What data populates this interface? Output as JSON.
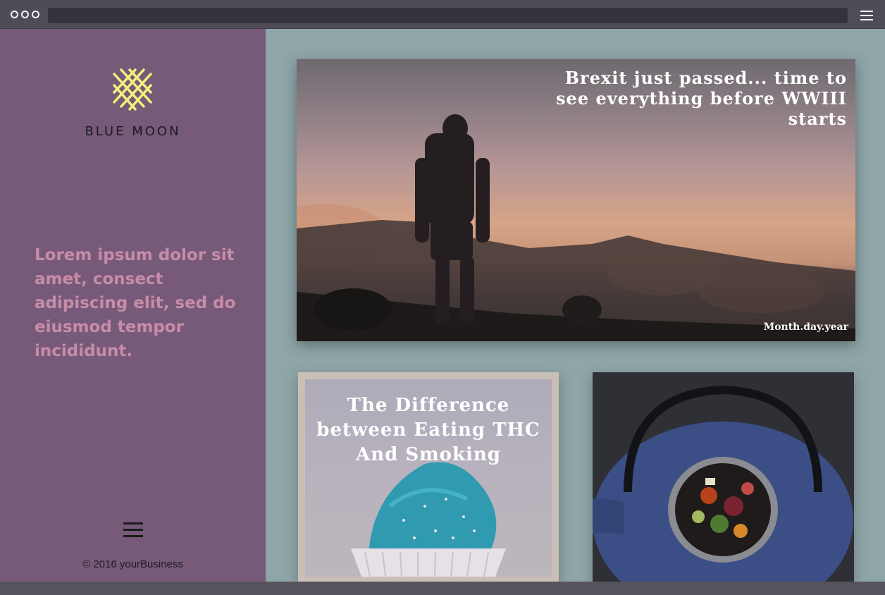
{
  "browser": {
    "icons": [
      "window-dots-icon",
      "hamburger-menu-icon"
    ]
  },
  "sidebar": {
    "brand_name": "BLUE MOON",
    "logo_icon": "crossed-lines-logo",
    "tagline": "Lorem ipsum dolor sit amet, consect adipiscing elit, sed do eiusmod tempor incididunt.",
    "menu_icon": "hamburger-menu-icon",
    "copyright": "© 2016 yourBusiness"
  },
  "main": {
    "hero": {
      "title": "Brexit just passed... time to see everything before WWIII starts",
      "date": "Month.day.year"
    },
    "cards": [
      {
        "title": "The Difference between Eating THC And Smoking"
      },
      {
        "title": ""
      }
    ]
  },
  "colors": {
    "sidebar_bg": "#775a79",
    "main_bg": "#8fa6a8",
    "accent_yellow": "#f5f07a",
    "tagline": "#c78ca8"
  }
}
